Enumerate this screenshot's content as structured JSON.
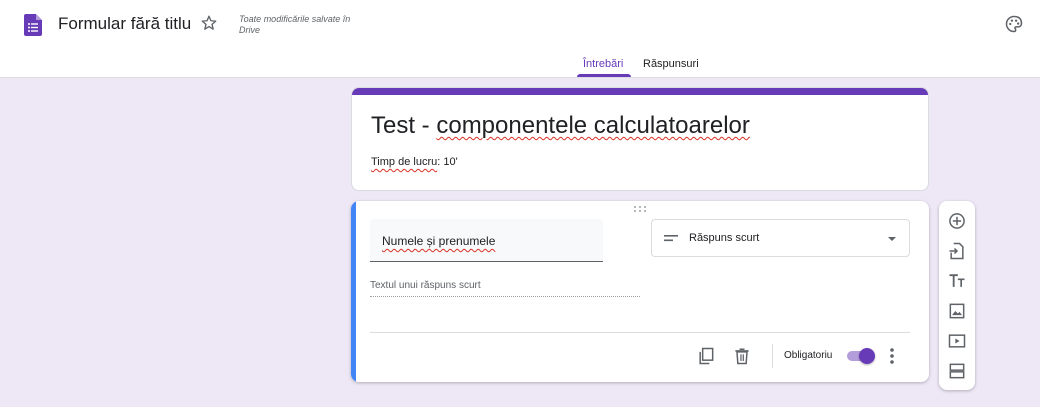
{
  "header": {
    "doc_title": "Formular fără titlu",
    "saved_status": "Toate modificările salvate în Drive",
    "tabs": [
      {
        "label": "Întrebări",
        "active": true
      },
      {
        "label": "Răspunsuri",
        "active": false
      }
    ]
  },
  "form": {
    "title": "Test - componentele calculatoarelor",
    "description_label": "Timp de lucru",
    "description_value": ": 10'"
  },
  "question": {
    "title": "Numele și prenumele",
    "type": "Răspuns scurt",
    "answer_placeholder": "Textul unui răspuns scurt",
    "required_label": "Obligatoriu",
    "required": true
  },
  "sidebar": {
    "tools": [
      "add-question-icon",
      "import-questions-icon",
      "title-text-icon",
      "image-icon",
      "video-icon",
      "section-icon"
    ]
  },
  "colors": {
    "accent": "#673ab7",
    "background": "#ede7f6",
    "active_question": "#4285f4"
  }
}
